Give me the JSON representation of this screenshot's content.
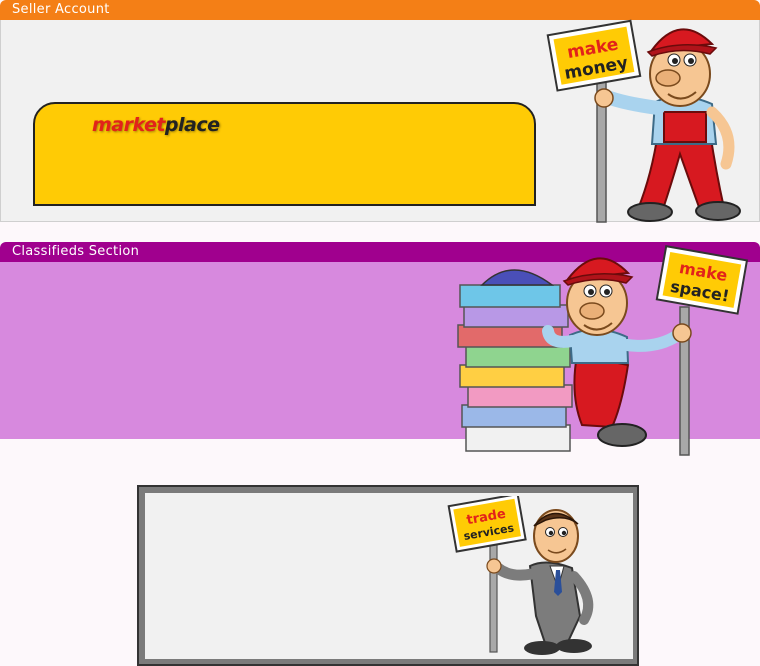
{
  "seller": {
    "title": "Seller Account",
    "logo_part1": "market",
    "logo_part2": "place",
    "sign_line1": "make",
    "sign_line2": "money"
  },
  "classifieds": {
    "title": "Classifieds Section",
    "sign_line1": "make",
    "sign_line2": "space!"
  },
  "trade": {
    "sign_line1": "trade",
    "sign_line2": "services"
  },
  "colors": {
    "seller_header": "#f47f16",
    "classifieds_header": "#a0008e",
    "classifieds_body": "#d789de",
    "marketplace_panel": "#ffcb05",
    "logo_red": "#e2231a"
  }
}
